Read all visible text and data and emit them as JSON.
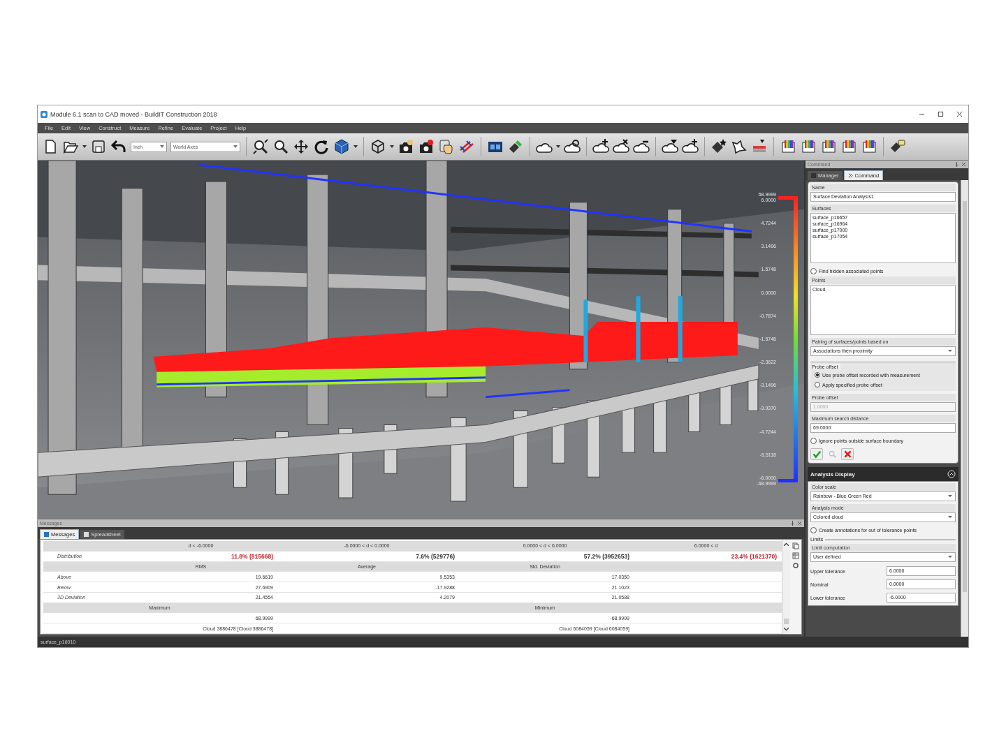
{
  "window": {
    "title": "Module 6.1 scan to CAD moved - BuildIT Construction 2018"
  },
  "menu": [
    "File",
    "Edit",
    "View",
    "Construct",
    "Measure",
    "Refine",
    "Evaluate",
    "Project",
    "Help"
  ],
  "toolbar": {
    "units": "Inch",
    "axes": "World Axes"
  },
  "legend": {
    "max": "68.9999",
    "min": "-68.9999",
    "ticks": [
      "6.0000",
      "4.7244",
      "3.1496",
      "1.5748",
      "0.0000",
      "-0.7874",
      "-1.5748",
      "-2.3622",
      "-3.1496",
      "-3.9370",
      "-4.7244",
      "-5.5118",
      "-6.0000"
    ]
  },
  "command_panel": {
    "title": "Command",
    "tabs": [
      {
        "label": "Manager",
        "selected": false
      },
      {
        "label": "Command",
        "selected": true
      }
    ],
    "name": {
      "label": "Name",
      "value": "Surface Deviation Analysis1"
    },
    "surfaces": {
      "label": "Surfaces",
      "items": [
        "surface_p16657",
        "surface_p16964",
        "surface_p17000",
        "surface_p17054"
      ]
    },
    "find_hidden": {
      "label": "Find hidden associated points",
      "checked": false
    },
    "points": {
      "label": "Points",
      "items": [
        "Cloud"
      ]
    },
    "pairing": {
      "label": "Pairing of surfaces/points based on",
      "value": "Associations then proximity"
    },
    "probe_group": {
      "label": "Probe offset",
      "options": [
        {
          "label": "Use probe offset recorded with measurement",
          "selected": true
        },
        {
          "label": "Apply specified probe offset",
          "selected": false
        }
      ]
    },
    "probe_offset": {
      "label": "Probe offset",
      "value": "1.0000",
      "disabled": true
    },
    "max_search": {
      "label": "Maximum search distance",
      "value": "69.0000",
      "disabled": false
    },
    "ignore_outside": {
      "label": "Ignore points outside surface boundary",
      "checked": false
    },
    "actions": [
      {
        "kind": "ok",
        "disabled": false
      },
      {
        "kind": "search",
        "disabled": true
      },
      {
        "kind": "cancel",
        "disabled": false
      }
    ]
  },
  "analysis_display": {
    "title": "Analysis Display",
    "expanded": true,
    "color_scale": {
      "label": "Color scale",
      "value": "Rainbow - Blue Green Red"
    },
    "analysis_mode": {
      "label": "Analysis mode",
      "value": "Colored cloud"
    },
    "annotations": {
      "label": "Create annotations for out of tolerance points",
      "checked": false
    },
    "limits_label": "Limits",
    "limit_computation": {
      "label": "Limit computation",
      "value": "User defined"
    },
    "tolerances": [
      {
        "label": "Upper tolerance",
        "value": "6.0000"
      },
      {
        "label": "Nominal",
        "value": "0.0000"
      },
      {
        "label": "Lower tolerance",
        "value": "-6.0000"
      }
    ]
  },
  "messages_panel": {
    "title": "Messages",
    "tabs": [
      {
        "label": "Messages",
        "selected": true
      },
      {
        "label": "Spreadsheet",
        "selected": false
      }
    ],
    "table": {
      "ranges": [
        "d < -6.0000",
        "-6.0000 < d < 0.0000",
        "0.0000 < d < 6.0000",
        "6.0000 < d"
      ],
      "distribution": {
        "label": "Distribution",
        "cells": [
          {
            "text": "11.8% (815668)",
            "color": "#c0282d"
          },
          {
            "text": "7.6% (529776)",
            "color": "#333333"
          },
          {
            "text": "57.2% (3952653)",
            "color": "#333333"
          },
          {
            "text": "23.4% (1621370)",
            "color": "#c0282d"
          }
        ]
      },
      "stats_headers": [
        "RMS",
        "Average",
        "Std. Deviation"
      ],
      "stats_rows": [
        {
          "label": "Above",
          "values": [
            "19.6619",
            "9.5353",
            "17.0350"
          ]
        },
        {
          "label": "Below",
          "values": [
            "27.6909",
            "-17.9288",
            "21.1023"
          ]
        },
        {
          "label": "3D Deviation",
          "values": [
            "21.4554",
            "4.2079",
            "21.0588"
          ]
        }
      ],
      "extreme_headers": [
        "Maximum",
        "Minimum"
      ],
      "extreme_values": [
        "68.9999",
        "-68.9999"
      ],
      "extreme_points": [
        "Cloud 3886478 [Cloud 3886478]",
        "Cloud 6084059 [Cloud 6084059]"
      ]
    }
  },
  "status_bar": "surface_p16010"
}
